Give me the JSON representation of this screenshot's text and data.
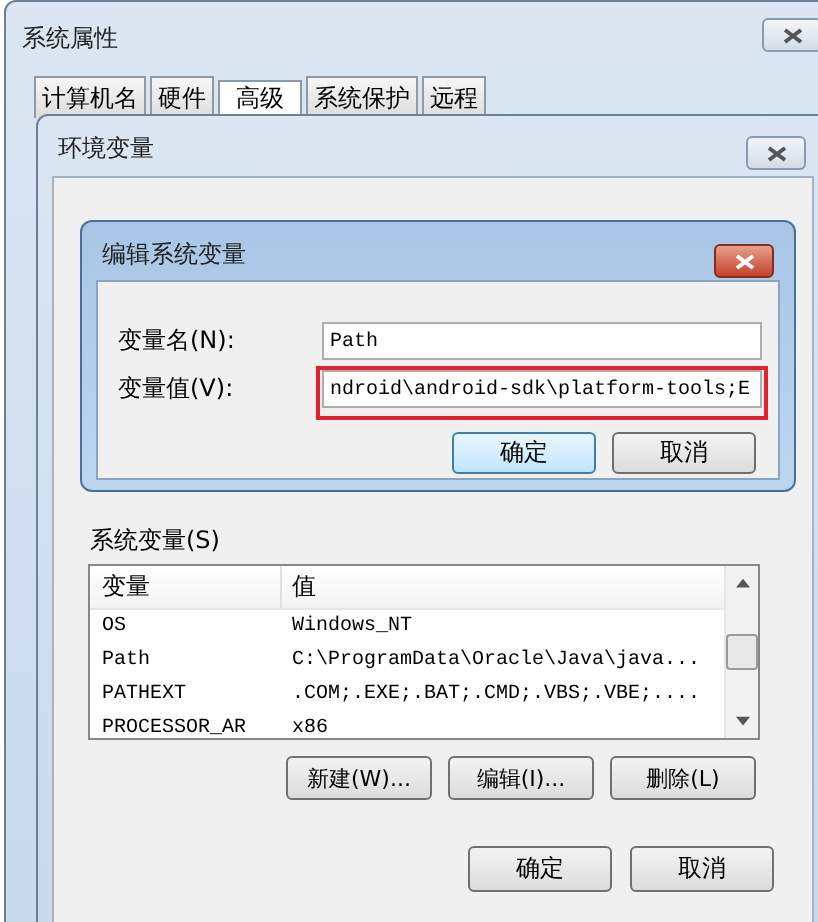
{
  "system_properties": {
    "title": "系统属性",
    "tabs": [
      {
        "label": "计算机名",
        "selected": false
      },
      {
        "label": "硬件",
        "selected": false
      },
      {
        "label": "高级",
        "selected": true
      },
      {
        "label": "系统保护",
        "selected": false
      },
      {
        "label": "远程",
        "selected": false
      }
    ]
  },
  "environment_variables": {
    "title": "环境变量",
    "system_variables_label": "系统变量(S)",
    "columns": [
      "变量",
      "值"
    ],
    "rows": [
      {
        "name": "OS",
        "value": "Windows_NT"
      },
      {
        "name": "Path",
        "value": "C:\\ProgramData\\Oracle\\Java\\java..."
      },
      {
        "name": "PATHEXT",
        "value": ".COM;.EXE;.BAT;.CMD;.VBS;.VBE;...."
      },
      {
        "name": "PROCESSOR_AR",
        "value": "x86"
      }
    ],
    "list_buttons": [
      "新建(W)...",
      "编辑(I)...",
      "删除(L)"
    ],
    "buttons": [
      "确定",
      "取消"
    ]
  },
  "edit_dialog": {
    "title": "编辑系统变量",
    "fields": [
      {
        "label": "变量名(N):",
        "value": "Path",
        "highlighted": false
      },
      {
        "label": "变量值(V):",
        "value": "ndroid\\android-sdk\\platform-tools;E",
        "highlighted": true
      }
    ],
    "buttons": [
      "确定",
      "取消"
    ]
  }
}
